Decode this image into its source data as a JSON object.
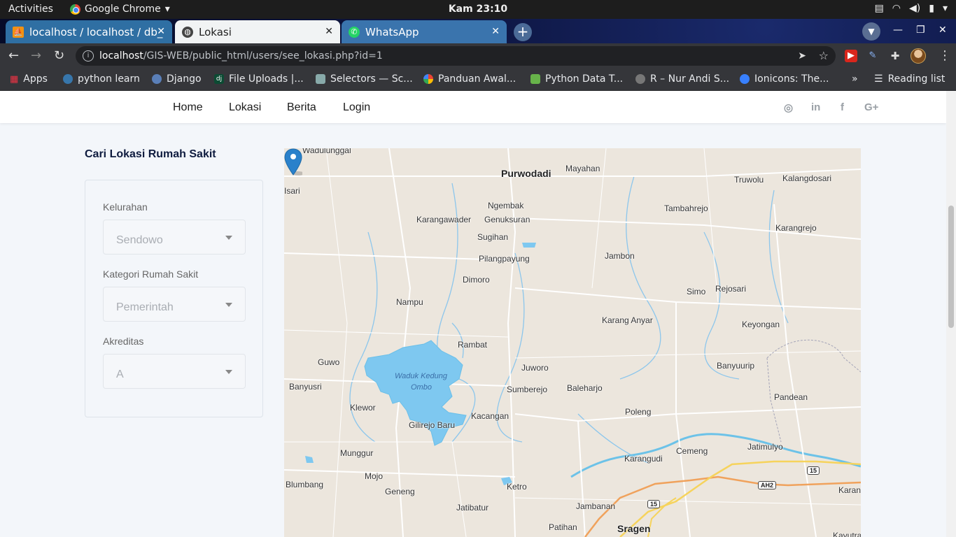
{
  "system": {
    "activities": "Activities",
    "app_name": "Google Chrome",
    "clock": "Kam 23:10"
  },
  "tabs": [
    {
      "title": "localhost / localhost / db_"
    },
    {
      "title": "Lokasi"
    },
    {
      "title": "WhatsApp"
    }
  ],
  "address_bar": {
    "host": "localhost",
    "path": "/GIS-WEB/public_html/users/see_lokasi.php?id=1"
  },
  "bookmarks": [
    {
      "label": "Apps"
    },
    {
      "label": "python learn"
    },
    {
      "label": "Django"
    },
    {
      "label": "File Uploads |..."
    },
    {
      "label": "Selectors — Sc..."
    },
    {
      "label": "Panduan Awal..."
    },
    {
      "label": "Python Data T..."
    },
    {
      "label": "R – Nur Andi S..."
    },
    {
      "label": "Ionicons: The..."
    },
    {
      "label": "Reading list"
    }
  ],
  "site_nav": {
    "home": "Home",
    "lokasi": "Lokasi",
    "berita": "Berita",
    "login": "Login",
    "social": [
      "instagram",
      "linkedin",
      "facebook",
      "google-plus"
    ]
  },
  "filter": {
    "title": "Cari Lokasi Rumah Sakit",
    "kelurahan_label": "Kelurahan",
    "kelurahan_value": "Sendowo",
    "kategori_label": "Kategori Rumah Sakit",
    "kategori_value": "Pemerintah",
    "akreditas_label": "Akreditas",
    "akreditas_value": "A"
  },
  "map": {
    "places": [
      "Wadulunggal",
      "Purwodadi",
      "Mayahan",
      "Truwolu",
      "Kalangdosari",
      "Tambahrejo",
      "Ngembak",
      "Karangawader",
      "Genuksuran",
      "Karangrejo",
      "Sugihan",
      "Jambon",
      "Pilangpayung",
      "Dimoro",
      "Simo",
      "Rejosari",
      "Nampu",
      "Karang Anyar",
      "Keyongan",
      "Rambat",
      "Guwo",
      "Juworo",
      "Banyuurip",
      "Banyusri",
      "Sumberejo",
      "Baleharjo",
      "Klewor",
      "Kacangan",
      "Poleng",
      "Pandean",
      "Gilirejo Baru",
      "Jatimulyo",
      "Munggur",
      "Cemeng",
      "Karangudi",
      "Mojo",
      "Blumbang",
      "Ketro",
      "Geneng",
      "Jatibatur",
      "Jambanan",
      "Patihan",
      "Sragen",
      "Karang",
      "Kayutra",
      "Isari"
    ],
    "lake_name_1": "Waduk Kedung",
    "lake_name_2": "Ombo",
    "road_shields": [
      "15",
      "AH2",
      "15"
    ]
  }
}
